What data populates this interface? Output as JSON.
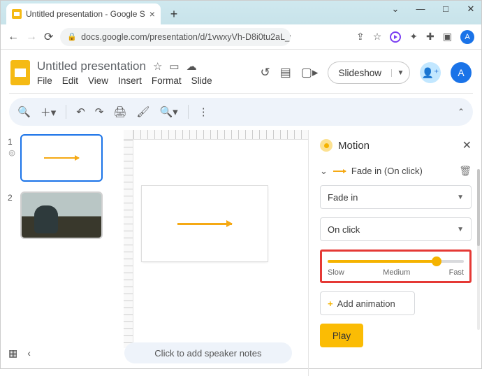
{
  "browser": {
    "tab_title": "Untitled presentation - Google S",
    "url": "docs.google.com/presentation/d/1vwxyVh-D8i0tu2aL_vfNHfpQv0...",
    "avatar_letter": "A"
  },
  "app": {
    "title": "Untitled presentation",
    "menus": [
      "File",
      "Edit",
      "View",
      "Insert",
      "Format",
      "Slide"
    ],
    "slideshow_label": "Slideshow",
    "avatar_letter": "A"
  },
  "thumbnails": [
    {
      "num": "1",
      "selected": true,
      "kind": "arrow"
    },
    {
      "num": "2",
      "selected": false,
      "kind": "photo"
    }
  ],
  "motion": {
    "title": "Motion",
    "animation_summary": "Fade in  (On click)",
    "effect": "Fade in",
    "trigger": "On click",
    "speed_labels": {
      "slow": "Slow",
      "medium": "Medium",
      "fast": "Fast"
    },
    "add_label": "Add animation",
    "play_label": "Play"
  },
  "footer": {
    "speaker_notes_placeholder": "Click to add speaker notes"
  }
}
